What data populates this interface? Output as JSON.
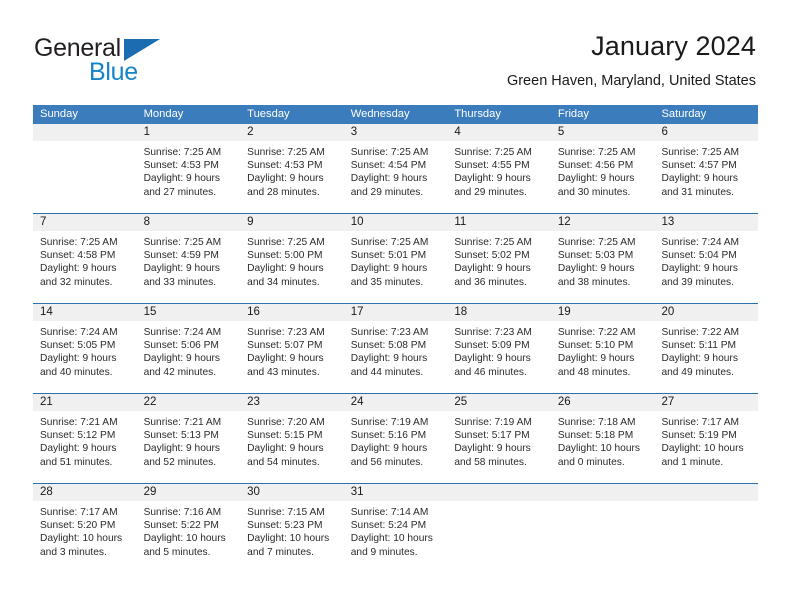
{
  "brand": {
    "word_general": "General",
    "word_blue": "Blue",
    "flag_icon": "triangle-flag-icon",
    "accent_color": "#1b6cb0",
    "blue_text_color": "#1583c8"
  },
  "header": {
    "title": "January 2024",
    "subtitle": "Green Haven, Maryland, United States"
  },
  "theme": {
    "header_bg": "#3b7dbc",
    "header_text": "#ffffff",
    "row_divider": "#2f6fae",
    "daynum_band": "#f0f0f0",
    "cell_bg": "#ffffff",
    "text": "#2b2b2b"
  },
  "weekdays": [
    "Sunday",
    "Monday",
    "Tuesday",
    "Wednesday",
    "Thursday",
    "Friday",
    "Saturday"
  ],
  "weeks": [
    {
      "days": [
        {
          "num": "",
          "lines": [
            "",
            "",
            "",
            ""
          ]
        },
        {
          "num": "1",
          "lines": [
            "Sunrise: 7:25 AM",
            "Sunset: 4:53 PM",
            "Daylight: 9 hours",
            "and 27 minutes."
          ]
        },
        {
          "num": "2",
          "lines": [
            "Sunrise: 7:25 AM",
            "Sunset: 4:53 PM",
            "Daylight: 9 hours",
            "and 28 minutes."
          ]
        },
        {
          "num": "3",
          "lines": [
            "Sunrise: 7:25 AM",
            "Sunset: 4:54 PM",
            "Daylight: 9 hours",
            "and 29 minutes."
          ]
        },
        {
          "num": "4",
          "lines": [
            "Sunrise: 7:25 AM",
            "Sunset: 4:55 PM",
            "Daylight: 9 hours",
            "and 29 minutes."
          ]
        },
        {
          "num": "5",
          "lines": [
            "Sunrise: 7:25 AM",
            "Sunset: 4:56 PM",
            "Daylight: 9 hours",
            "and 30 minutes."
          ]
        },
        {
          "num": "6",
          "lines": [
            "Sunrise: 7:25 AM",
            "Sunset: 4:57 PM",
            "Daylight: 9 hours",
            "and 31 minutes."
          ]
        }
      ]
    },
    {
      "days": [
        {
          "num": "7",
          "lines": [
            "Sunrise: 7:25 AM",
            "Sunset: 4:58 PM",
            "Daylight: 9 hours",
            "and 32 minutes."
          ]
        },
        {
          "num": "8",
          "lines": [
            "Sunrise: 7:25 AM",
            "Sunset: 4:59 PM",
            "Daylight: 9 hours",
            "and 33 minutes."
          ]
        },
        {
          "num": "9",
          "lines": [
            "Sunrise: 7:25 AM",
            "Sunset: 5:00 PM",
            "Daylight: 9 hours",
            "and 34 minutes."
          ]
        },
        {
          "num": "10",
          "lines": [
            "Sunrise: 7:25 AM",
            "Sunset: 5:01 PM",
            "Daylight: 9 hours",
            "and 35 minutes."
          ]
        },
        {
          "num": "11",
          "lines": [
            "Sunrise: 7:25 AM",
            "Sunset: 5:02 PM",
            "Daylight: 9 hours",
            "and 36 minutes."
          ]
        },
        {
          "num": "12",
          "lines": [
            "Sunrise: 7:25 AM",
            "Sunset: 5:03 PM",
            "Daylight: 9 hours",
            "and 38 minutes."
          ]
        },
        {
          "num": "13",
          "lines": [
            "Sunrise: 7:24 AM",
            "Sunset: 5:04 PM",
            "Daylight: 9 hours",
            "and 39 minutes."
          ]
        }
      ]
    },
    {
      "days": [
        {
          "num": "14",
          "lines": [
            "Sunrise: 7:24 AM",
            "Sunset: 5:05 PM",
            "Daylight: 9 hours",
            "and 40 minutes."
          ]
        },
        {
          "num": "15",
          "lines": [
            "Sunrise: 7:24 AM",
            "Sunset: 5:06 PM",
            "Daylight: 9 hours",
            "and 42 minutes."
          ]
        },
        {
          "num": "16",
          "lines": [
            "Sunrise: 7:23 AM",
            "Sunset: 5:07 PM",
            "Daylight: 9 hours",
            "and 43 minutes."
          ]
        },
        {
          "num": "17",
          "lines": [
            "Sunrise: 7:23 AM",
            "Sunset: 5:08 PM",
            "Daylight: 9 hours",
            "and 44 minutes."
          ]
        },
        {
          "num": "18",
          "lines": [
            "Sunrise: 7:23 AM",
            "Sunset: 5:09 PM",
            "Daylight: 9 hours",
            "and 46 minutes."
          ]
        },
        {
          "num": "19",
          "lines": [
            "Sunrise: 7:22 AM",
            "Sunset: 5:10 PM",
            "Daylight: 9 hours",
            "and 48 minutes."
          ]
        },
        {
          "num": "20",
          "lines": [
            "Sunrise: 7:22 AM",
            "Sunset: 5:11 PM",
            "Daylight: 9 hours",
            "and 49 minutes."
          ]
        }
      ]
    },
    {
      "days": [
        {
          "num": "21",
          "lines": [
            "Sunrise: 7:21 AM",
            "Sunset: 5:12 PM",
            "Daylight: 9 hours",
            "and 51 minutes."
          ]
        },
        {
          "num": "22",
          "lines": [
            "Sunrise: 7:21 AM",
            "Sunset: 5:13 PM",
            "Daylight: 9 hours",
            "and 52 minutes."
          ]
        },
        {
          "num": "23",
          "lines": [
            "Sunrise: 7:20 AM",
            "Sunset: 5:15 PM",
            "Daylight: 9 hours",
            "and 54 minutes."
          ]
        },
        {
          "num": "24",
          "lines": [
            "Sunrise: 7:19 AM",
            "Sunset: 5:16 PM",
            "Daylight: 9 hours",
            "and 56 minutes."
          ]
        },
        {
          "num": "25",
          "lines": [
            "Sunrise: 7:19 AM",
            "Sunset: 5:17 PM",
            "Daylight: 9 hours",
            "and 58 minutes."
          ]
        },
        {
          "num": "26",
          "lines": [
            "Sunrise: 7:18 AM",
            "Sunset: 5:18 PM",
            "Daylight: 10 hours",
            "and 0 minutes."
          ]
        },
        {
          "num": "27",
          "lines": [
            "Sunrise: 7:17 AM",
            "Sunset: 5:19 PM",
            "Daylight: 10 hours",
            "and 1 minute."
          ]
        }
      ]
    },
    {
      "days": [
        {
          "num": "28",
          "lines": [
            "Sunrise: 7:17 AM",
            "Sunset: 5:20 PM",
            "Daylight: 10 hours",
            "and 3 minutes."
          ]
        },
        {
          "num": "29",
          "lines": [
            "Sunrise: 7:16 AM",
            "Sunset: 5:22 PM",
            "Daylight: 10 hours",
            "and 5 minutes."
          ]
        },
        {
          "num": "30",
          "lines": [
            "Sunrise: 7:15 AM",
            "Sunset: 5:23 PM",
            "Daylight: 10 hours",
            "and 7 minutes."
          ]
        },
        {
          "num": "31",
          "lines": [
            "Sunrise: 7:14 AM",
            "Sunset: 5:24 PM",
            "Daylight: 10 hours",
            "and 9 minutes."
          ]
        },
        {
          "num": "",
          "lines": [
            "",
            "",
            "",
            ""
          ]
        },
        {
          "num": "",
          "lines": [
            "",
            "",
            "",
            ""
          ]
        },
        {
          "num": "",
          "lines": [
            "",
            "",
            "",
            ""
          ]
        }
      ]
    }
  ]
}
